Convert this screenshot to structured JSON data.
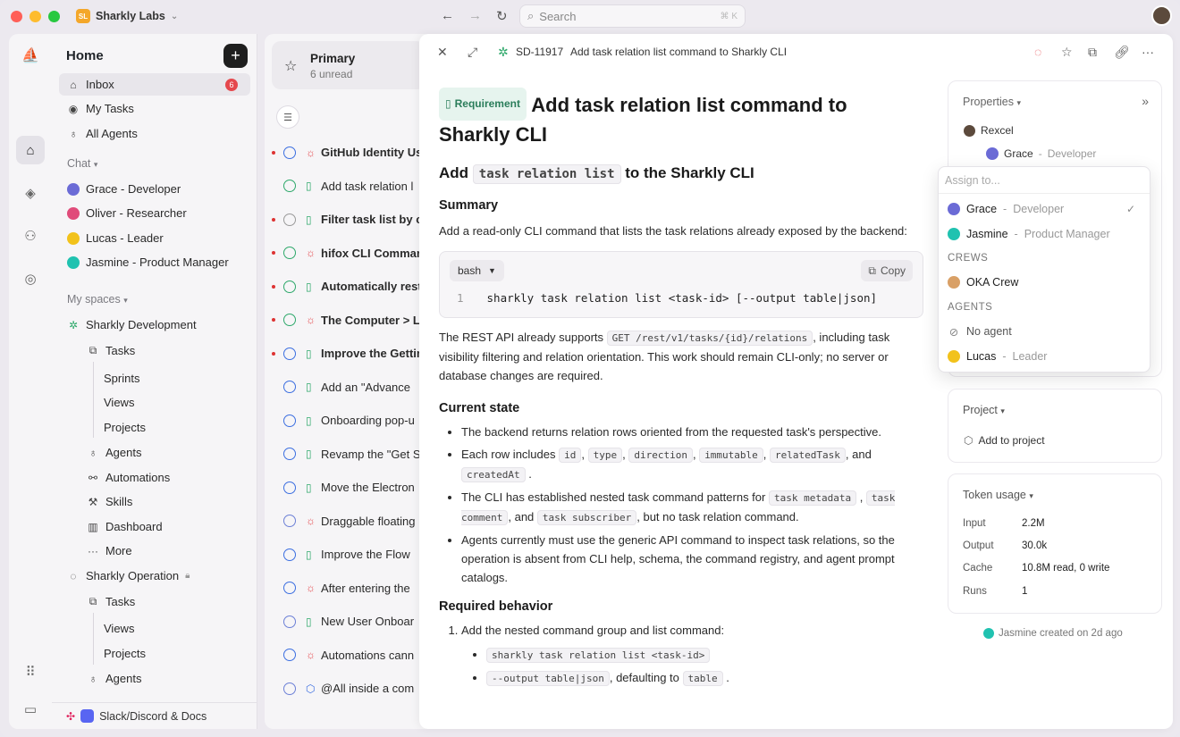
{
  "workspace": {
    "name": "Sharkly Labs",
    "logo": "SL"
  },
  "search": {
    "placeholder": "Search",
    "shortcut": "⌘ K"
  },
  "sidebar": {
    "home_title": "Home",
    "inbox_label": "Inbox",
    "inbox_count": "6",
    "my_tasks": "My Tasks",
    "all_agents": "All Agents",
    "chat_section": "Chat",
    "chats": [
      {
        "label": "Grace - Developer",
        "color": "#6b6bd6"
      },
      {
        "label": "Oliver - Researcher",
        "color": "#e04b7a"
      },
      {
        "label": "Lucas - Leader",
        "color": "#f2c21b"
      },
      {
        "label": "Jasmine - Product Manager",
        "color": "#20c2b0"
      }
    ],
    "spaces_section": "My spaces",
    "space1": {
      "name": "Sharkly Development",
      "tasks": "Tasks",
      "task_children": [
        "Sprints",
        "Views",
        "Projects"
      ],
      "agents": "Agents",
      "automations": "Automations",
      "skills": "Skills",
      "dashboard": "Dashboard",
      "more": "More"
    },
    "space2": {
      "name": "Sharkly Operation",
      "tasks": "Tasks",
      "task_children": [
        "Views",
        "Projects"
      ],
      "agents": "Agents"
    },
    "footer": "Slack/Discord & Docs"
  },
  "tasklist": {
    "primary_title": "Primary",
    "primary_sub": "6 unread",
    "tasks": [
      {
        "title": "GitHub Identity Us",
        "unread": true,
        "bold": true,
        "type": "bug",
        "status": "#3b6ee0"
      },
      {
        "title": "Add task relation l",
        "unread": false,
        "bold": false,
        "type": "doc",
        "status": "#2da86a"
      },
      {
        "title": "Filter task list by c",
        "unread": true,
        "bold": true,
        "type": "doc",
        "status": "#999999"
      },
      {
        "title": "hifox CLI Comman",
        "unread": true,
        "bold": true,
        "type": "bug",
        "status": "#2da86a"
      },
      {
        "title": "Automatically rest",
        "unread": true,
        "bold": true,
        "type": "doc",
        "status": "#2da86a"
      },
      {
        "title": "The Computer > L",
        "unread": true,
        "bold": true,
        "type": "bug",
        "status": "#2da86a"
      },
      {
        "title": "Improve the Gettin",
        "unread": true,
        "bold": true,
        "type": "doc",
        "status": "#3b6ee0"
      },
      {
        "title": "Add an \"Advance",
        "unread": false,
        "bold": false,
        "type": "doc",
        "status": "#3b6ee0"
      },
      {
        "title": "Onboarding pop-u",
        "unread": false,
        "bold": false,
        "type": "doc",
        "status": "#3b6ee0"
      },
      {
        "title": "Revamp the \"Get S",
        "unread": false,
        "bold": false,
        "type": "doc",
        "status": "#3b6ee0"
      },
      {
        "title": "Move the Electron",
        "unread": false,
        "bold": false,
        "type": "doc",
        "status": "#3b6ee0"
      },
      {
        "title": "Draggable floating",
        "unread": false,
        "bold": false,
        "type": "bug",
        "status": "#6b7fd6"
      },
      {
        "title": "Improve the Flow",
        "unread": false,
        "bold": false,
        "type": "doc",
        "status": "#3b6ee0"
      },
      {
        "title": "After entering the",
        "unread": false,
        "bold": false,
        "type": "bug",
        "status": "#3b6ee0"
      },
      {
        "title": "New User Onboar",
        "unread": false,
        "bold": false,
        "type": "doc",
        "status": "#6b7fd6"
      },
      {
        "title": "Automations cann",
        "unread": false,
        "bold": false,
        "type": "bug",
        "status": "#3b6ee0"
      },
      {
        "title": "@All inside a com",
        "unread": false,
        "bold": false,
        "type": "hex",
        "status": "#6b7fd6"
      }
    ]
  },
  "detail": {
    "id": "SD-11917",
    "header_title": "Add task relation list command to Sharkly CLI",
    "badge": "Requirement",
    "title": "Add task relation list command to Sharkly CLI",
    "h2_pre": "Add",
    "h2_code": "task relation list",
    "h2_post": "to the Sharkly CLI",
    "summary_h": "Summary",
    "summary_p": "Add a read-only CLI command that lists the task relations already exposed by the backend:",
    "code_lang": "bash",
    "copy_label": "Copy",
    "code_line_no": "1",
    "code_line": "sharkly task relation list <task-id> [--output table|json]",
    "rest_pre": "The REST API already supports",
    "rest_code": "GET /rest/v1/tasks/{id}/relations",
    "rest_post": ", including task visibility filtering and relation orientation. This work should remain CLI-only; no server or database changes are required.",
    "current_h": "Current state",
    "cs1": "The backend returns relation rows oriented from the requested task's perspective.",
    "cs2_pre": "Each row includes",
    "cs2_codes": [
      "id",
      "type",
      "direction",
      "immutable",
      "relatedTask",
      "createdAt"
    ],
    "cs2_and": ", and",
    "cs3_pre": "The CLI has established nested task command patterns for",
    "cs3_c1": "task metadata",
    "cs3_c2": "task comment",
    "cs3_and": ", and",
    "cs3_c3": "task subscriber",
    "cs3_post": ", but no task relation command.",
    "cs4": "Agents currently must use the generic API command to inspect task relations, so the operation is absent from CLI help, schema, the command registry, and agent prompt catalogs.",
    "required_h": "Required behavior",
    "rb1": "Add the nested command group and list command:",
    "rb1_c1": "sharkly task relation list <task-id>",
    "rb1_c2": "--output table|json",
    "rb1_c2_post": ", defaulting to",
    "rb1_c3": "table"
  },
  "properties": {
    "title": "Properties",
    "owner": "Rexcel",
    "assignee_name": "Grace",
    "assignee_role": "Developer",
    "dropdown": {
      "placeholder": "Assign to...",
      "members": [
        {
          "name": "Grace",
          "role": "Developer",
          "color": "#6b6bd6",
          "checked": true
        },
        {
          "name": "Jasmine",
          "role": "Product Manager",
          "color": "#20c2b0",
          "checked": false
        }
      ],
      "crews_label": "CREWS",
      "crew": "OKA Crew",
      "agents_label": "AGENTS",
      "no_agent": "No agent",
      "agent_name": "Lucas",
      "agent_role": "Leader"
    }
  },
  "project": {
    "title": "Project",
    "add": "Add to project"
  },
  "token_usage": {
    "title": "Token usage",
    "rows": [
      {
        "label": "Input",
        "value": "2.2M"
      },
      {
        "label": "Output",
        "value": "30.0k"
      },
      {
        "label": "Cache",
        "value": "10.8M read, 0 write"
      },
      {
        "label": "Runs",
        "value": "1"
      }
    ]
  },
  "created_note": "Jasmine created on 2d ago"
}
